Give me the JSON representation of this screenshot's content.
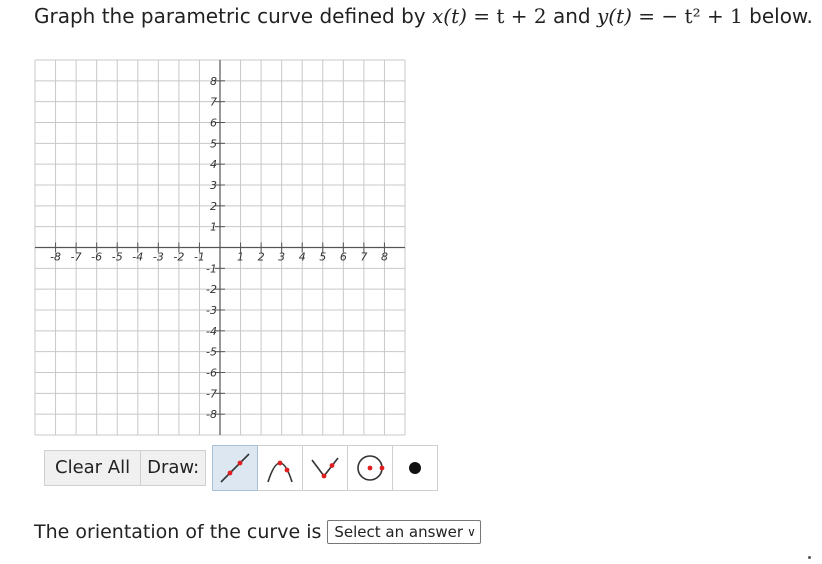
{
  "question": {
    "prefix": "Graph the parametric curve defined by ",
    "x_var": "x(t)",
    "x_expr": " = t + 2",
    "and": " and ",
    "y_var": "y(t)",
    "y_expr": " = − t² + 1",
    "suffix": " below."
  },
  "graph": {
    "x_min": -8,
    "x_max": 8,
    "y_min": -8,
    "y_max": 8,
    "x_ticks": [
      "-8",
      "-7",
      "-6",
      "-5",
      "-4",
      "-3",
      "-2",
      "-1",
      "1",
      "2",
      "3",
      "4",
      "5",
      "6",
      "7",
      "8"
    ],
    "y_ticks": [
      "8",
      "7",
      "6",
      "5",
      "4",
      "3",
      "2",
      "1",
      "-1",
      "-2",
      "-3",
      "-4",
      "-5",
      "-6",
      "-7",
      "-8"
    ],
    "grid_color": "#c8c8c8",
    "axis_color": "#555555"
  },
  "toolbar": {
    "clear_label": "Clear All",
    "draw_label": "Draw:",
    "tools": [
      {
        "icon": "line-tool-icon",
        "selected": true
      },
      {
        "icon": "parabola-tool-icon",
        "selected": false
      },
      {
        "icon": "absolute-value-tool-icon",
        "selected": false
      },
      {
        "icon": "circle-tool-icon",
        "selected": false
      },
      {
        "icon": "point-tool-icon",
        "selected": false
      }
    ]
  },
  "orientation": {
    "text": "The orientation of the curve is",
    "select_value": "Select an answer"
  }
}
